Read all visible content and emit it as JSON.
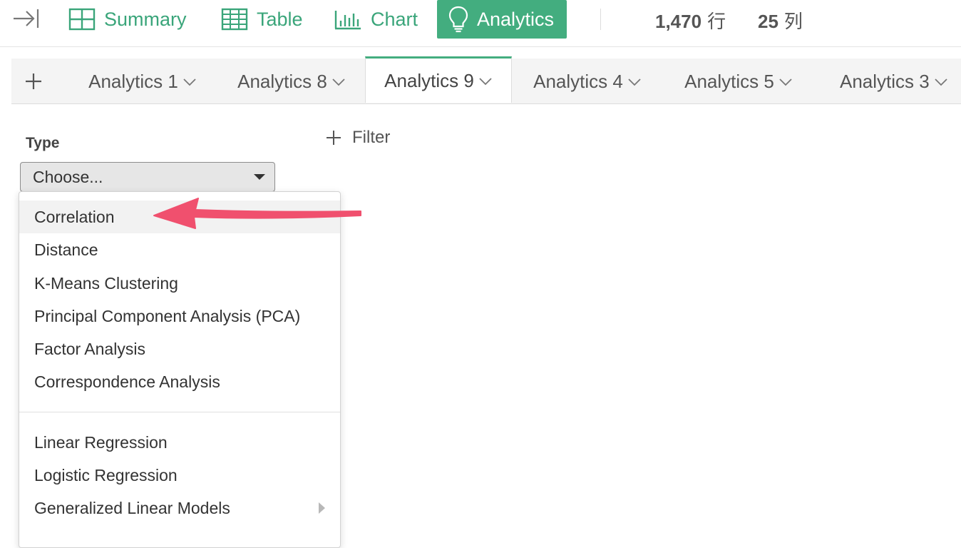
{
  "toolbar": {
    "views": [
      {
        "label": "Summary",
        "icon": "summary-grid-icon"
      },
      {
        "label": "Table",
        "icon": "table-icon"
      },
      {
        "label": "Chart",
        "icon": "bar-chart-icon"
      },
      {
        "label": "Analytics",
        "icon": "lightbulb-icon"
      }
    ],
    "active_view": "Analytics",
    "rows_value": "1,470",
    "rows_unit": "行",
    "cols_value": "25",
    "cols_unit": "列"
  },
  "tabs": {
    "items": [
      {
        "label": "Analytics 1"
      },
      {
        "label": "Analytics 8"
      },
      {
        "label": "Analytics 9"
      },
      {
        "label": "Analytics 4"
      },
      {
        "label": "Analytics 5"
      },
      {
        "label": "Analytics 3"
      }
    ],
    "active": "Analytics 9"
  },
  "panel": {
    "type_label": "Type",
    "type_select_value": "Choose...",
    "filter_label": "Filter"
  },
  "dropdown": {
    "group1": [
      "Correlation",
      "Distance",
      "K-Means Clustering",
      "Principal Component Analysis (PCA)",
      "Factor Analysis",
      "Correspondence Analysis"
    ],
    "group2": [
      "Linear Regression",
      "Logistic Regression",
      "Generalized Linear Models"
    ],
    "highlighted": "Correlation",
    "has_submenu": "Generalized Linear Models"
  },
  "colors": {
    "accent": "#43ad7f",
    "accent_text": "#3aa57a",
    "annotation_arrow": "#f0506e"
  }
}
